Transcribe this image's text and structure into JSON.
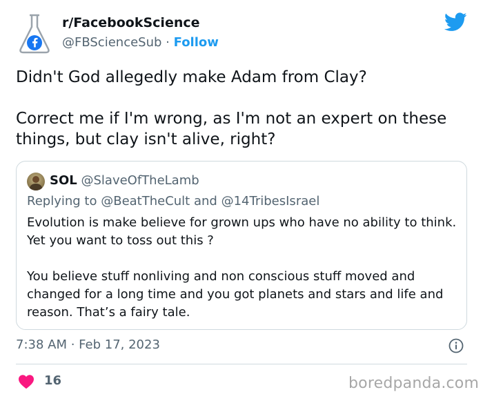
{
  "author": {
    "name": "r/FacebookScience",
    "handle": "@FBScienceSub",
    "separator": "·",
    "follow_label": "Follow",
    "avatar_icon": "flask-facebook-icon"
  },
  "tweet": {
    "paragraphs": [
      "Didn't God allegedly make Adam from Clay?",
      "Correct me if I'm wrong, as I'm not an expert on these things, but clay isn't alive, right?"
    ]
  },
  "quote": {
    "name": "SOL",
    "handle": "@SlaveOfTheLamb",
    "replying_prefix": "Replying to",
    "mention_1": "@BeatTheCult",
    "and_word": "and",
    "mention_2": "@14TribesIsrael",
    "paragraphs": [
      "Evolution is make believe for grown ups who have no ability to think. Yet you want to toss out this ?",
      "You believe stuff nonliving and non conscious stuff moved and changed for a long time and you got planets and stars and life and reason. That’s a fairy tale."
    ]
  },
  "meta": {
    "timestamp": "7:38 AM · Feb 17, 2023"
  },
  "engagement": {
    "likes": "16"
  },
  "watermark": "boredpanda.com",
  "colors": {
    "twitter_blue": "#1d9bf0",
    "heart_red": "#f91880",
    "secondary_text": "#536471",
    "border": "#cfd9de"
  }
}
